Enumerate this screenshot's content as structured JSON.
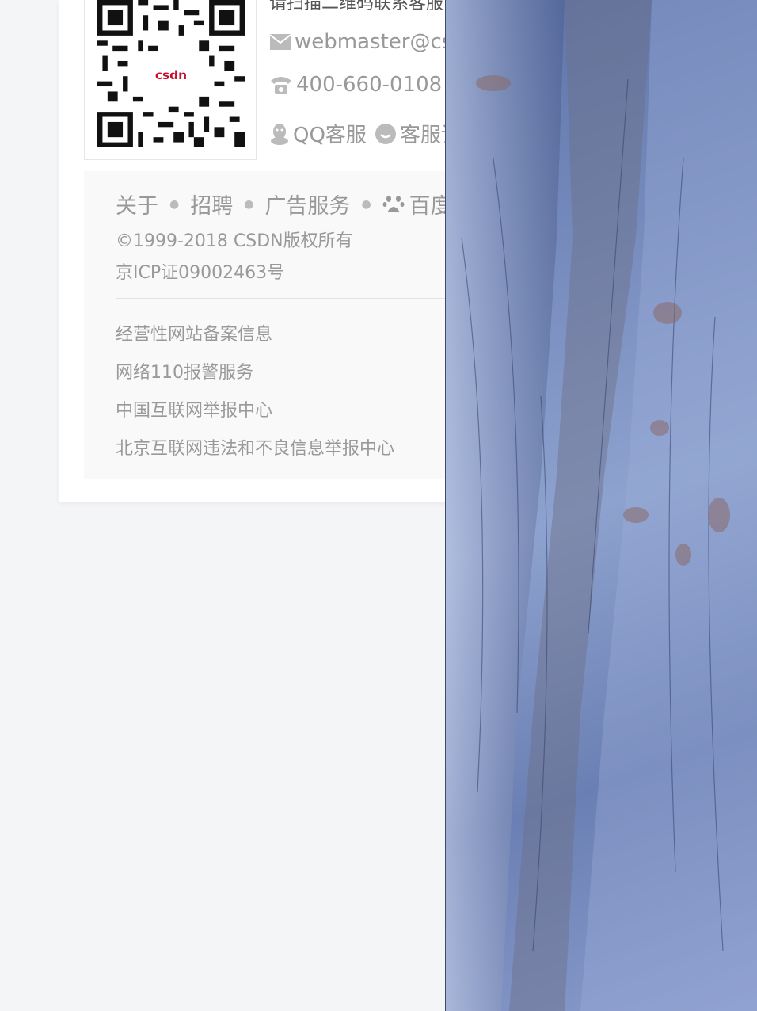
{
  "contact": {
    "scan_text": "请扫描二维码联系客服",
    "email": "webmaster@csdn.net",
    "phone": "400-660-0108",
    "qq_label": "QQ客服",
    "service_label": "客服论坛",
    "qr_logo": "csdn"
  },
  "footer": {
    "nav": {
      "about": "关于",
      "jobs": "招聘",
      "ads": "广告服务",
      "baidu": "百度"
    },
    "copyright": "©1999-2018 CSDN版权所有",
    "icp": "京ICP证09002463号",
    "links": [
      "经营性网站备案信息",
      "网络110报警服务",
      "中国互联网举报中心",
      "北京互联网违法和不良信息举报中心"
    ]
  },
  "icons": {
    "email": "mail-icon",
    "phone": "phone-icon",
    "qq": "qq-penguin-icon",
    "service": "chat-bubble-icon",
    "baidu": "baidu-paw-icon"
  },
  "colors": {
    "page_bg": "#f4f5f7",
    "card_bg": "#ffffff",
    "footer_bg": "#f9f9f9",
    "text_muted": "#999999",
    "photo_blue": "#7a8fc0"
  }
}
